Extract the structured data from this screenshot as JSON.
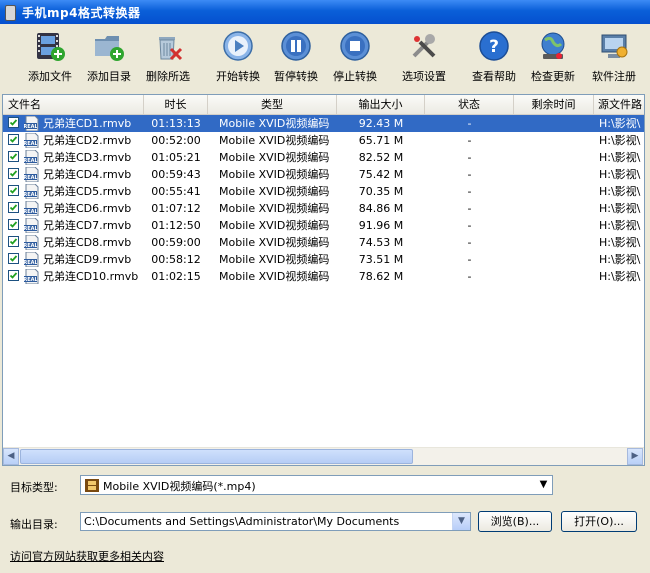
{
  "window": {
    "title": "手机mp4格式转换器"
  },
  "toolbar": {
    "add_file": "添加文件",
    "add_dir": "添加目录",
    "delete_selected": "删除所选",
    "start": "开始转换",
    "pause": "暂停转换",
    "stop": "停止转换",
    "options": "选项设置",
    "help": "查看帮助",
    "check_update": "检查更新",
    "register": "软件注册"
  },
  "table": {
    "headers": [
      "文件名",
      "时长",
      "类型",
      "输出大小",
      "状态",
      "剩余时间",
      "源文件路"
    ],
    "rows": [
      {
        "name": "兄弟连CD1.rmvb",
        "duration": "01:13:13",
        "type": "Mobile XVID视频编码",
        "size": "92.43 M",
        "status": "-",
        "path": "H:\\影视\\",
        "checked": true,
        "selected": true
      },
      {
        "name": "兄弟连CD2.rmvb",
        "duration": "00:52:00",
        "type": "Mobile XVID视频编码",
        "size": "65.71 M",
        "status": "-",
        "path": "H:\\影视\\",
        "checked": true,
        "selected": false
      },
      {
        "name": "兄弟连CD3.rmvb",
        "duration": "01:05:21",
        "type": "Mobile XVID视频编码",
        "size": "82.52 M",
        "status": "-",
        "path": "H:\\影视\\",
        "checked": true,
        "selected": false
      },
      {
        "name": "兄弟连CD4.rmvb",
        "duration": "00:59:43",
        "type": "Mobile XVID视频编码",
        "size": "75.42 M",
        "status": "-",
        "path": "H:\\影视\\",
        "checked": true,
        "selected": false
      },
      {
        "name": "兄弟连CD5.rmvb",
        "duration": "00:55:41",
        "type": "Mobile XVID视频编码",
        "size": "70.35 M",
        "status": "-",
        "path": "H:\\影视\\",
        "checked": true,
        "selected": false
      },
      {
        "name": "兄弟连CD6.rmvb",
        "duration": "01:07:12",
        "type": "Mobile XVID视频编码",
        "size": "84.86 M",
        "status": "-",
        "path": "H:\\影视\\",
        "checked": true,
        "selected": false
      },
      {
        "name": "兄弟连CD7.rmvb",
        "duration": "01:12:50",
        "type": "Mobile XVID视频编码",
        "size": "91.96 M",
        "status": "-",
        "path": "H:\\影视\\",
        "checked": true,
        "selected": false
      },
      {
        "name": "兄弟连CD8.rmvb",
        "duration": "00:59:00",
        "type": "Mobile XVID视频编码",
        "size": "74.53 M",
        "status": "-",
        "path": "H:\\影视\\",
        "checked": true,
        "selected": false
      },
      {
        "name": "兄弟连CD9.rmvb",
        "duration": "00:58:12",
        "type": "Mobile XVID视频编码",
        "size": "73.51 M",
        "status": "-",
        "path": "H:\\影视\\",
        "checked": true,
        "selected": false
      },
      {
        "name": "兄弟连CD10.rmvb",
        "duration": "01:02:15",
        "type": "Mobile XVID视频编码",
        "size": "78.62 M",
        "status": "-",
        "path": "H:\\影视\\",
        "checked": true,
        "selected": false
      }
    ]
  },
  "form": {
    "target_type_label": "目标类型:",
    "target_type_value": "Mobile XVID视频编码(*.mp4)",
    "output_dir_label": "输出目录:",
    "output_dir_value": "C:\\Documents and Settings\\Administrator\\My Documents",
    "browse": "浏览(B)...",
    "open": "打开(O)..."
  },
  "footer": {
    "link": "访问官方网站获取更多相关内容"
  },
  "colors": {
    "selection": "#316ac5",
    "titlebar": "#0a5fd8"
  }
}
